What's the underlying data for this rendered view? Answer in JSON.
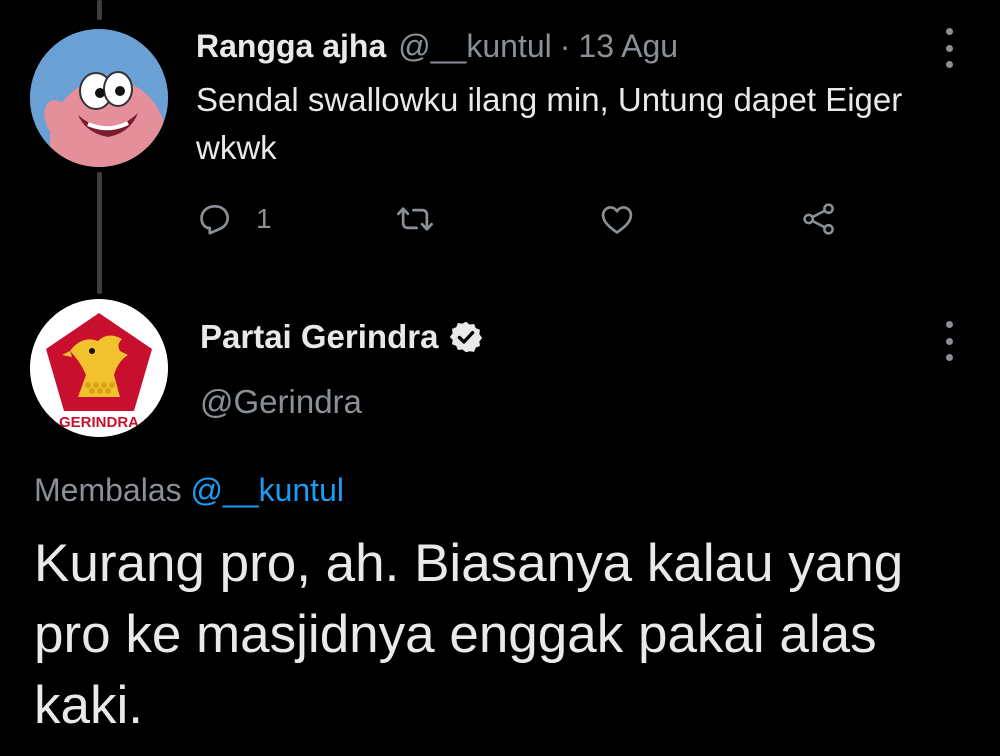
{
  "tweet1": {
    "display_name": "Rangga ajha",
    "handle": "@__kuntul",
    "separator": "·",
    "date": "13 Agu",
    "text": "Sendal swallowku ilang min, Untung dapet Eiger wkwk",
    "reply_count": "1",
    "avatar_icon": "cartoon-avatar"
  },
  "tweet2": {
    "display_name": "Partai Gerindra",
    "handle": "@Gerindra",
    "verified": true,
    "avatar_icon": "gerindra-eagle-logo",
    "avatar_logo_text": "GERINDRA",
    "replying_label": "Membalas",
    "replying_mention": "@__kuntul",
    "text": "Kurang pro, ah. Biasanya kalau yang pro ke masjidnya enggak pakai alas kaki."
  },
  "icons": {
    "reply": "reply-icon",
    "retweet": "retweet-icon",
    "like": "heart-icon",
    "share": "share-icon",
    "more": "more-vertical-icon",
    "verified": "verified-badge-icon"
  },
  "colors": {
    "background": "#000000",
    "text": "#e7e9ea",
    "secondary": "#8b9096",
    "link": "#1d9bf0",
    "thread_line": "#3b3e42"
  }
}
